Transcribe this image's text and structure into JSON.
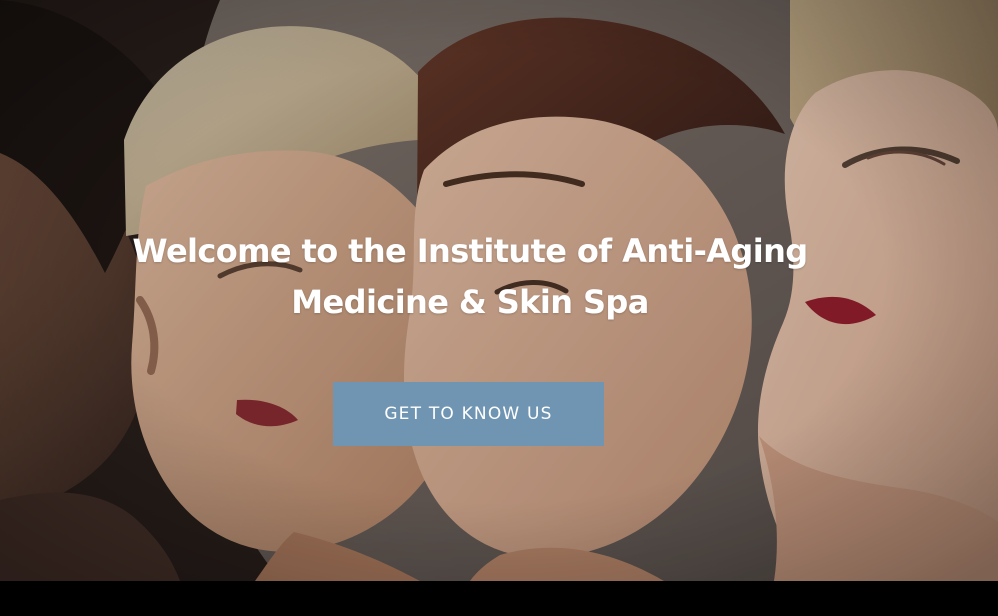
{
  "hero": {
    "title_line_1": "Welcome to the Institute of Anti-Aging",
    "title_line_2": "Medicine & Skin Spa",
    "button_label": "GET TO KNOW US"
  },
  "colors": {
    "button_background": "#6f95b3",
    "text": "#ffffff",
    "bottom_bar": "#000000"
  }
}
